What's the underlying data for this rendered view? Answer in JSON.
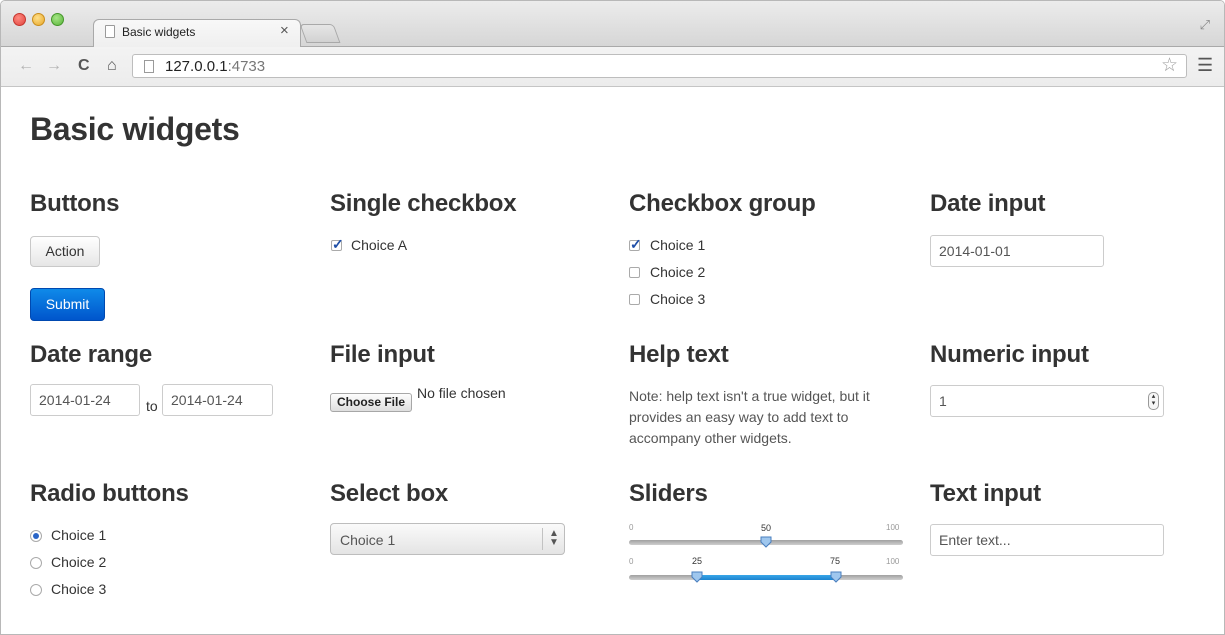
{
  "browser": {
    "tab_title": "Basic widgets",
    "tab_close": "×",
    "url_host": "127.0.0.1",
    "url_port": ":4733"
  },
  "page": {
    "title": "Basic widgets"
  },
  "buttons": {
    "heading": "Buttons",
    "action_label": "Action",
    "submit_label": "Submit"
  },
  "single_checkbox": {
    "heading": "Single checkbox",
    "label": "Choice A",
    "checked": true
  },
  "checkbox_group": {
    "heading": "Checkbox group",
    "options": [
      {
        "label": "Choice 1",
        "checked": true
      },
      {
        "label": "Choice 2",
        "checked": false
      },
      {
        "label": "Choice 3",
        "checked": false
      }
    ]
  },
  "date_input": {
    "heading": "Date input",
    "value": "2014-01-01"
  },
  "date_range": {
    "heading": "Date range",
    "start": "2014-01-24",
    "separator": "to",
    "end": "2014-01-24"
  },
  "file_input": {
    "heading": "File input",
    "button_label": "Choose File",
    "status": "No file chosen"
  },
  "help_text": {
    "heading": "Help text",
    "lines": [
      "Note: help text isn't a true widget, but it",
      "provides an easy way to add text to",
      "accompany other widgets."
    ]
  },
  "numeric_input": {
    "heading": "Numeric input",
    "value": "1"
  },
  "radio_buttons": {
    "heading": "Radio buttons",
    "options": [
      {
        "label": "Choice 1",
        "selected": true
      },
      {
        "label": "Choice 2",
        "selected": false
      },
      {
        "label": "Choice 3",
        "selected": false
      }
    ]
  },
  "select_box": {
    "heading": "Select box",
    "selected": "Choice 1"
  },
  "sliders": {
    "heading": "Sliders",
    "slider1": {
      "min": "0",
      "max": "100",
      "value": "50"
    },
    "slider2": {
      "min": "0",
      "max": "100",
      "low": "25",
      "high": "75"
    }
  },
  "text_input": {
    "heading": "Text input",
    "placeholder": "Enter text..."
  }
}
